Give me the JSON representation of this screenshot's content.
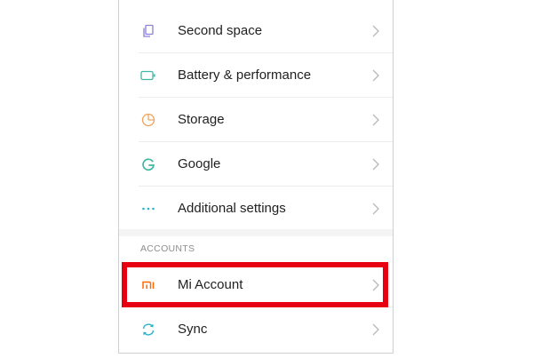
{
  "settings": {
    "items": [
      {
        "label": "Second space",
        "icon": "second-space-icon"
      },
      {
        "label": "Battery & performance",
        "icon": "battery-icon"
      },
      {
        "label": "Storage",
        "icon": "storage-icon"
      },
      {
        "label": "Google",
        "icon": "google-icon"
      },
      {
        "label": "Additional settings",
        "icon": "more-dots-icon"
      }
    ],
    "accounts_header": "ACCOUNTS",
    "accounts_items": [
      {
        "label": "Mi Account",
        "icon": "mi-logo-icon"
      },
      {
        "label": "Sync",
        "icon": "sync-icon"
      }
    ]
  },
  "colors": {
    "highlight": "#e60012",
    "icon_purple": "#8a7fd6",
    "icon_green": "#3fb8a3",
    "icon_orange": "#f0a35a",
    "icon_teal": "#2bb3c9",
    "mi_orange": "#ff6900"
  }
}
